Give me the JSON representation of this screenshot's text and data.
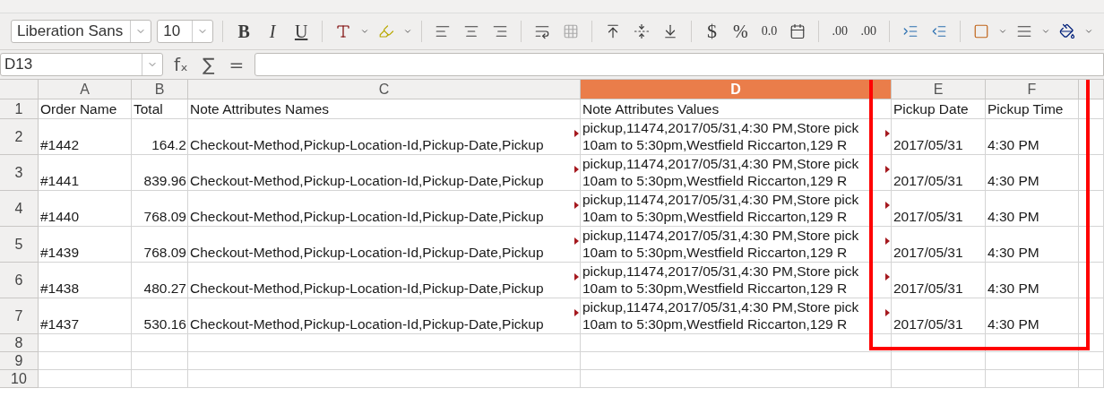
{
  "toolbar": {
    "font_name": "Liberation Sans",
    "font_size": "10",
    "bold": "B",
    "italic": "I",
    "underline": "U",
    "currency": "$",
    "percent": "%",
    "number_format": "0.0",
    "add_decimal": ".00",
    "delete_decimal": ".00"
  },
  "formula_bar": {
    "name_box": "D13",
    "function_wizard": "fₓ",
    "sum": "∑",
    "equals": "="
  },
  "columns": [
    {
      "label": "A",
      "selected": false
    },
    {
      "label": "B",
      "selected": false
    },
    {
      "label": "C",
      "selected": false
    },
    {
      "label": "D",
      "selected": true
    },
    {
      "label": "E",
      "selected": false
    },
    {
      "label": "F",
      "selected": false
    }
  ],
  "rows": [
    {
      "number": "1",
      "cells": [
        {
          "lines": [
            "Order Name"
          ]
        },
        {
          "lines": [
            "Total"
          ]
        },
        {
          "lines": [
            "Note Attributes Names"
          ]
        },
        {
          "lines": [
            "Note Attributes Values"
          ]
        },
        {
          "lines": [
            "Pickup Date"
          ]
        },
        {
          "lines": [
            "Pickup Time"
          ]
        }
      ]
    },
    {
      "number": "2",
      "cells": [
        {
          "lines": [
            "#1442"
          ]
        },
        {
          "lines": [
            "164.2"
          ]
        },
        {
          "lines": [
            "Checkout-Method,Pickup-Location-Id,Pickup-Date,Pickup"
          ],
          "overflow": true
        },
        {
          "lines": [
            "pickup,11474,2017/05/31,4:30 PM,Store pick",
            "10am to 5:30pm,Westfield Riccarton,129 R"
          ],
          "overflow": true
        },
        {
          "lines": [
            "2017/05/31"
          ]
        },
        {
          "lines": [
            "4:30 PM"
          ]
        }
      ]
    },
    {
      "number": "3",
      "cells": [
        {
          "lines": [
            "#1441"
          ]
        },
        {
          "lines": [
            "839.96"
          ]
        },
        {
          "lines": [
            "Checkout-Method,Pickup-Location-Id,Pickup-Date,Pickup"
          ],
          "overflow": true
        },
        {
          "lines": [
            "pickup,11474,2017/05/31,4:30 PM,Store pick",
            "10am to 5:30pm,Westfield Riccarton,129 R"
          ],
          "overflow": true
        },
        {
          "lines": [
            "2017/05/31"
          ]
        },
        {
          "lines": [
            "4:30 PM"
          ]
        }
      ]
    },
    {
      "number": "4",
      "cells": [
        {
          "lines": [
            "#1440"
          ]
        },
        {
          "lines": [
            "768.09"
          ]
        },
        {
          "lines": [
            "Checkout-Method,Pickup-Location-Id,Pickup-Date,Pickup"
          ],
          "overflow": true
        },
        {
          "lines": [
            "pickup,11474,2017/05/31,4:30 PM,Store pick",
            "10am to 5:30pm,Westfield Riccarton,129 R"
          ],
          "overflow": true
        },
        {
          "lines": [
            "2017/05/31"
          ]
        },
        {
          "lines": [
            "4:30 PM"
          ]
        }
      ]
    },
    {
      "number": "5",
      "cells": [
        {
          "lines": [
            "#1439"
          ]
        },
        {
          "lines": [
            "768.09"
          ]
        },
        {
          "lines": [
            "Checkout-Method,Pickup-Location-Id,Pickup-Date,Pickup"
          ],
          "overflow": true
        },
        {
          "lines": [
            "pickup,11474,2017/05/31,4:30 PM,Store pick",
            "10am to 5:30pm,Westfield Riccarton,129 R"
          ],
          "overflow": true
        },
        {
          "lines": [
            "2017/05/31"
          ]
        },
        {
          "lines": [
            "4:30 PM"
          ]
        }
      ]
    },
    {
      "number": "6",
      "cells": [
        {
          "lines": [
            "#1438"
          ]
        },
        {
          "lines": [
            "480.27"
          ]
        },
        {
          "lines": [
            "Checkout-Method,Pickup-Location-Id,Pickup-Date,Pickup"
          ],
          "overflow": true
        },
        {
          "lines": [
            "pickup,11474,2017/05/31,4:30 PM,Store pick",
            "10am to 5:30pm,Westfield Riccarton,129 R"
          ],
          "overflow": true
        },
        {
          "lines": [
            "2017/05/31"
          ]
        },
        {
          "lines": [
            "4:30 PM"
          ]
        }
      ]
    },
    {
      "number": "7",
      "cells": [
        {
          "lines": [
            "#1437"
          ]
        },
        {
          "lines": [
            "530.16"
          ]
        },
        {
          "lines": [
            "Checkout-Method,Pickup-Location-Id,Pickup-Date,Pickup"
          ],
          "overflow": true
        },
        {
          "lines": [
            "pickup,11474,2017/05/31,4:30 PM,Store pick",
            "10am to 5:30pm,Westfield Riccarton,129 R"
          ],
          "overflow": true
        },
        {
          "lines": [
            "2017/05/31"
          ]
        },
        {
          "lines": [
            "4:30 PM"
          ]
        }
      ]
    },
    {
      "number": "8",
      "cells": []
    },
    {
      "number": "9",
      "cells": []
    },
    {
      "number": "10",
      "cells": []
    }
  ],
  "highlight_rect": true
}
